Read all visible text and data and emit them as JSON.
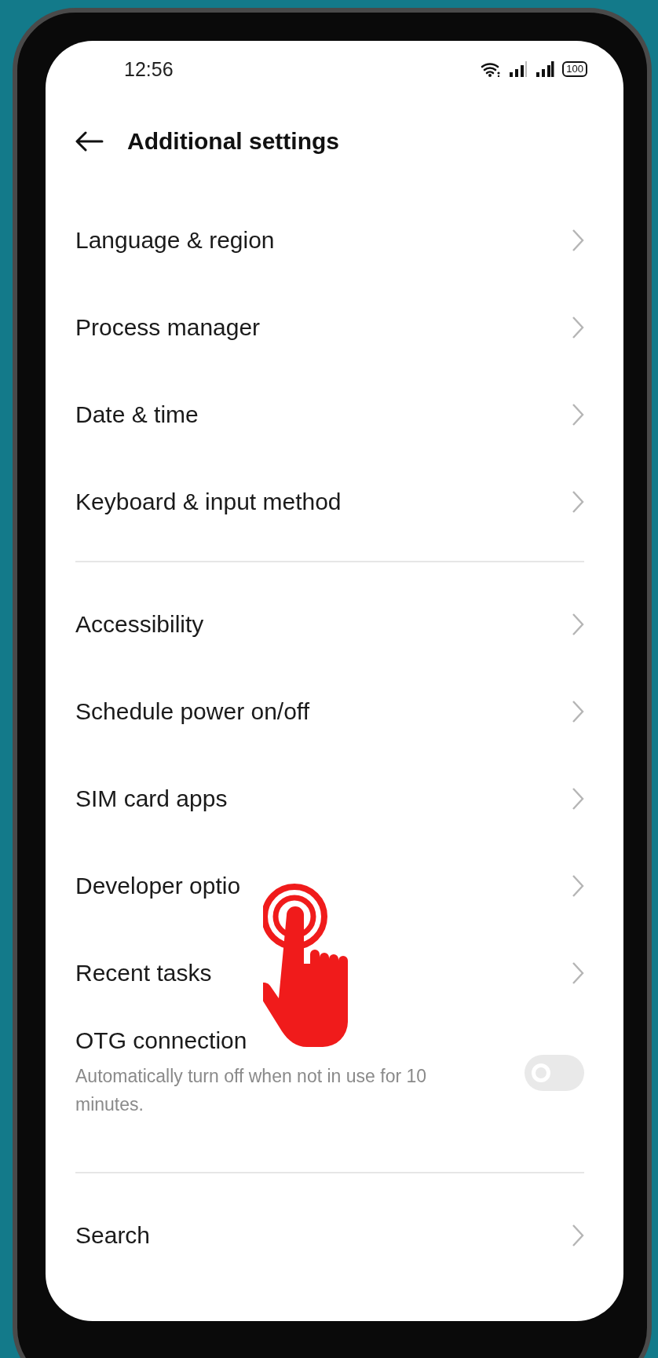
{
  "status_bar": {
    "time": "12:56",
    "battery": "100"
  },
  "header": {
    "title": "Additional settings"
  },
  "sections": [
    {
      "items": [
        {
          "kind": "link",
          "label": "Language & region"
        },
        {
          "kind": "link",
          "label": "Process manager"
        },
        {
          "kind": "link",
          "label": "Date & time"
        },
        {
          "kind": "link",
          "label": "Keyboard & input method"
        }
      ]
    },
    {
      "items": [
        {
          "kind": "link",
          "label": "Accessibility"
        },
        {
          "kind": "link",
          "label": "Schedule power on/off"
        },
        {
          "kind": "link",
          "label": "SIM card apps"
        },
        {
          "kind": "link",
          "label": "Developer optio",
          "tapped": true
        },
        {
          "kind": "link",
          "label": "Recent tasks"
        },
        {
          "kind": "toggle",
          "label": "OTG connection",
          "description": "Automatically turn off when not in use for 10 minutes.",
          "on": false
        }
      ]
    },
    {
      "items": [
        {
          "kind": "link",
          "label": "Search"
        }
      ]
    }
  ]
}
